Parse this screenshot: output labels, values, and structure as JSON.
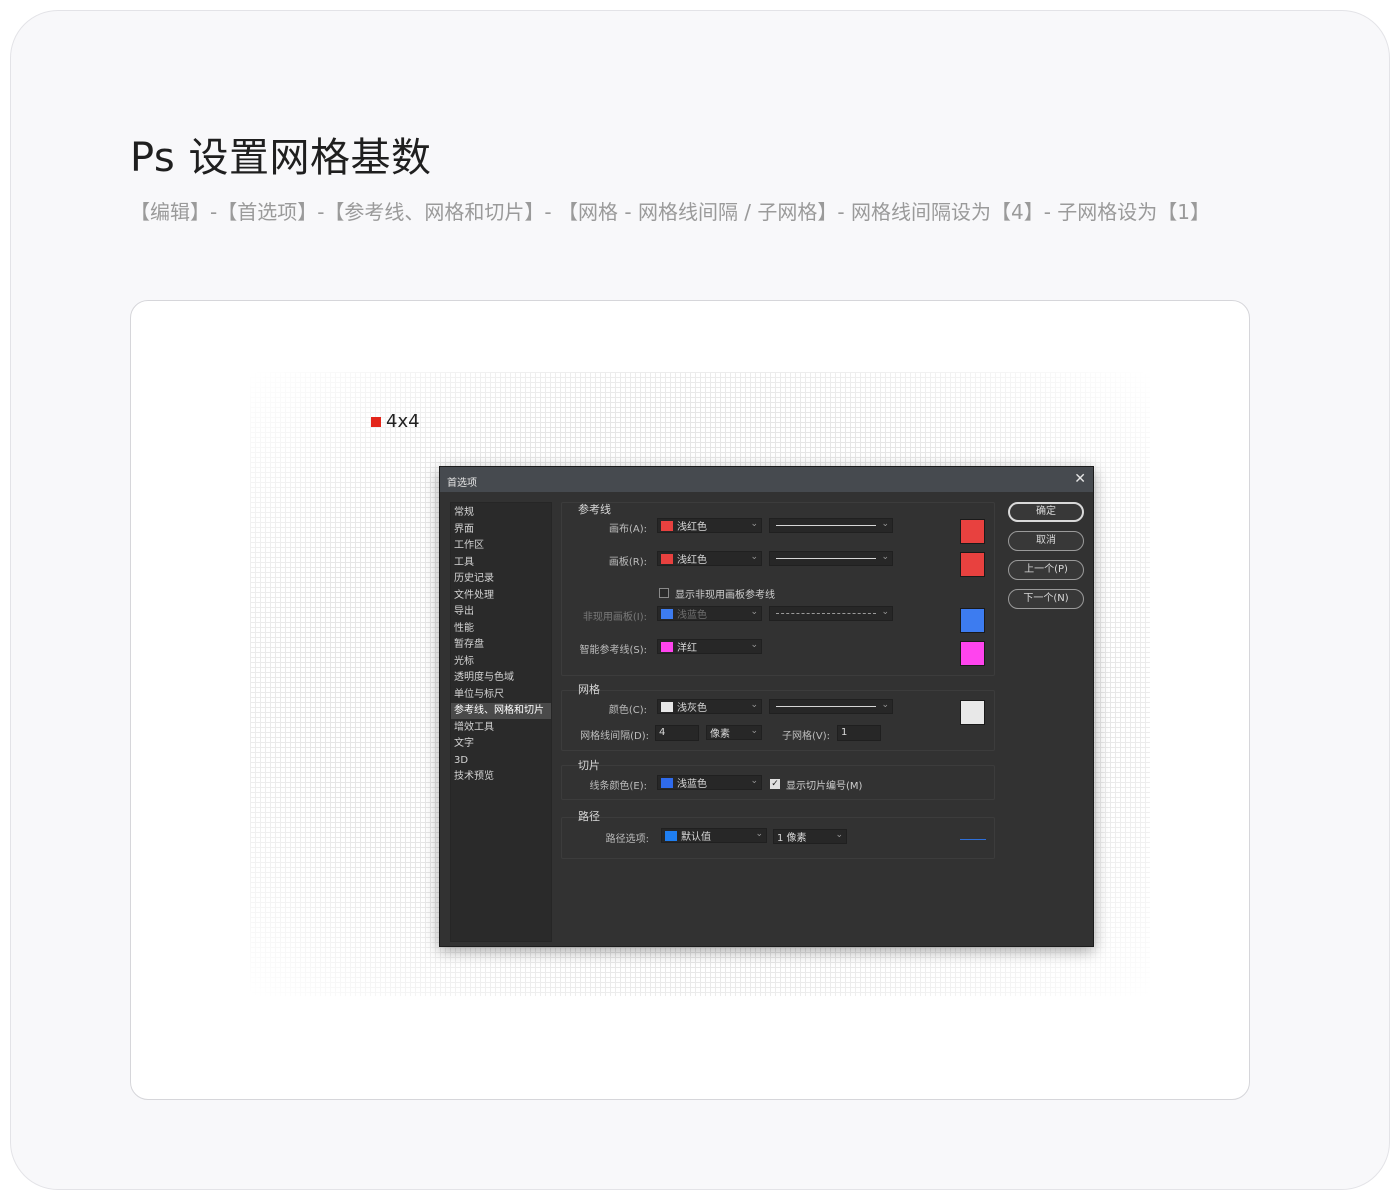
{
  "page": {
    "title": "Ps 设置网格基数",
    "subtitle": "【编辑】-【首选项】-【参考线、网格和切片】- 【网格 - 网格线间隔 / 子网格】- 网格线间隔设为【4】- 子网格设为【1】",
    "legend_label": "4x4",
    "legend_color": "#e3261b"
  },
  "dialog": {
    "title": "首选项",
    "close_glyph": "✕",
    "nav": [
      {
        "label": "常规"
      },
      {
        "label": "界面"
      },
      {
        "label": "工作区"
      },
      {
        "label": "工具"
      },
      {
        "label": "历史记录"
      },
      {
        "label": "文件处理"
      },
      {
        "label": "导出"
      },
      {
        "label": "性能"
      },
      {
        "label": "暂存盘"
      },
      {
        "label": "光标"
      },
      {
        "label": "透明度与色域"
      },
      {
        "label": "单位与标尺"
      },
      {
        "label": "参考线、网格和切片",
        "active": true
      },
      {
        "label": "增效工具"
      },
      {
        "label": "文字"
      },
      {
        "label": "3D"
      },
      {
        "label": "技术预览"
      }
    ],
    "guides": {
      "heading": "参考线",
      "canvas_label": "画布(A):",
      "canvas_color_name": "浅红色",
      "canvas_color": "#e8413f",
      "artboard_label": "画板(R):",
      "artboard_color_name": "浅红色",
      "artboard_color": "#e8413f",
      "show_inactive_label": "显示非现用画板参考线",
      "show_inactive_checked": false,
      "inactive_label": "非现用画板(I):",
      "inactive_color_name": "浅蓝色",
      "inactive_color": "#3d7cf0",
      "smart_label": "智能参考线(S):",
      "smart_color_name": "洋红",
      "smart_color": "#ff44ee"
    },
    "grid": {
      "heading": "网格",
      "color_label": "颜色(C):",
      "color_name": "浅灰色",
      "color": "#e8e8e8",
      "spacing_label": "网格线间隔(D):",
      "spacing_value": "4",
      "unit": "像素",
      "subdiv_label": "子网格(V):",
      "subdiv_value": "1"
    },
    "slices": {
      "heading": "切片",
      "line_color_label": "线条颜色(E):",
      "line_color_name": "浅蓝色",
      "line_color": "#2f6bec",
      "show_numbers_label": "显示切片编号(M)",
      "show_numbers_checked": true
    },
    "path": {
      "heading": "路径",
      "options_label": "路径选项:",
      "color_name": "默认值",
      "color": "#1f7ef0",
      "width": "1 像素"
    },
    "buttons": {
      "ok": "确定",
      "cancel": "取消",
      "prev": "上一个(P)",
      "next": "下一个(N)"
    }
  }
}
